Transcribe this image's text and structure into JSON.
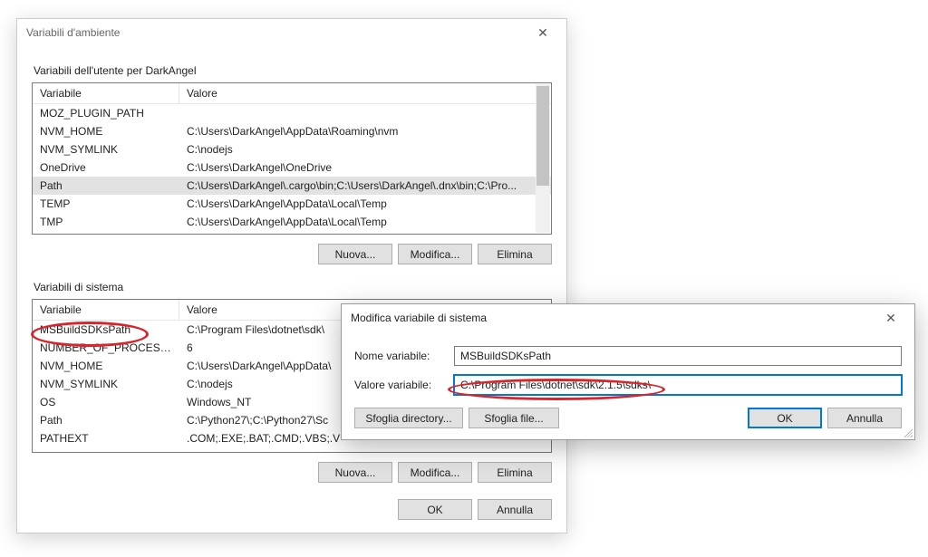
{
  "envDialog": {
    "title": "Variabili d'ambiente",
    "closeGlyph": "✕",
    "userGroupLabel": "Variabili dell'utente per DarkAngel",
    "systemGroupLabel": "Variabili di sistema",
    "headers": {
      "var": "Variabile",
      "val": "Valore"
    },
    "userVars": [
      {
        "name": "MOZ_PLUGIN_PATH",
        "value": ""
      },
      {
        "name": "NVM_HOME",
        "value": "C:\\Users\\DarkAngel\\AppData\\Roaming\\nvm"
      },
      {
        "name": "NVM_SYMLINK",
        "value": "C:\\nodejs"
      },
      {
        "name": "OneDrive",
        "value": "C:\\Users\\DarkAngel\\OneDrive"
      },
      {
        "name": "Path",
        "value": "C:\\Users\\DarkAngel\\.cargo\\bin;C:\\Users\\DarkAngel\\.dnx\\bin;C:\\Pro..."
      },
      {
        "name": "TEMP",
        "value": "C:\\Users\\DarkAngel\\AppData\\Local\\Temp"
      },
      {
        "name": "TMP",
        "value": "C:\\Users\\DarkAngel\\AppData\\Local\\Temp"
      }
    ],
    "userSelectedIndex": 4,
    "systemVars": [
      {
        "name": "MSBuildSDKsPath",
        "value": "C:\\Program Files\\dotnet\\sdk\\"
      },
      {
        "name": "NUMBER_OF_PROCESSORS",
        "value": "6"
      },
      {
        "name": "NVM_HOME",
        "value": "C:\\Users\\DarkAngel\\AppData\\"
      },
      {
        "name": "NVM_SYMLINK",
        "value": "C:\\nodejs"
      },
      {
        "name": "OS",
        "value": "Windows_NT"
      },
      {
        "name": "Path",
        "value": "C:\\Python27\\;C:\\Python27\\Sc"
      },
      {
        "name": "PATHEXT",
        "value": ".COM;.EXE;.BAT;.CMD;.VBS;.V"
      }
    ],
    "buttons": {
      "new": "Nuova...",
      "edit": "Modifica...",
      "delete": "Elimina",
      "ok": "OK",
      "cancel": "Annulla"
    }
  },
  "editDialog": {
    "title": "Modifica variabile di sistema",
    "closeGlyph": "✕",
    "nameLabel": "Nome variabile:",
    "nameValue": "MSBuildSDKsPath",
    "valueLabel": "Valore variabile:",
    "valueValue": "C:\\Program Files\\dotnet\\sdk\\2.1.5\\sdks\\",
    "buttons": {
      "browseDir": "Sfoglia directory...",
      "browseFile": "Sfoglia file...",
      "ok": "OK",
      "cancel": "Annulla"
    }
  }
}
